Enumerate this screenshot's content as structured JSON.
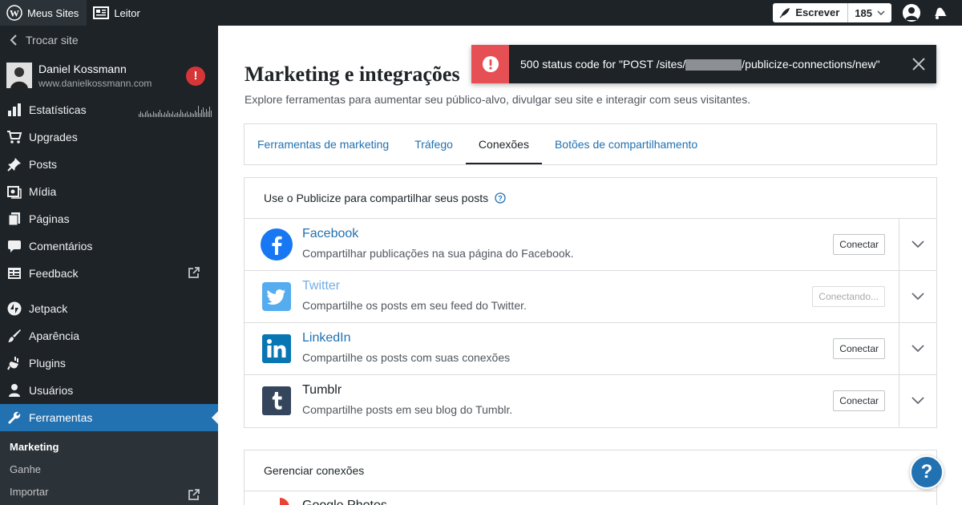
{
  "masterbar": {
    "my_sites": "Meus Sites",
    "reader": "Leitor",
    "write": "Escrever",
    "notification_count": "185"
  },
  "sidebar": {
    "switch_site": "Trocar site",
    "site_name": "Daniel Kossmann",
    "site_url": "www.danielkossmann.com",
    "site_alert": "!",
    "items": [
      {
        "label": "Estatísticas",
        "icon": "stats-icon"
      },
      {
        "label": "Upgrades",
        "icon": "cart-icon"
      },
      {
        "label": "Posts",
        "icon": "pin-icon"
      },
      {
        "label": "Mídia",
        "icon": "media-icon"
      },
      {
        "label": "Páginas",
        "icon": "pages-icon"
      },
      {
        "label": "Comentários",
        "icon": "comment-icon"
      },
      {
        "label": "Feedback",
        "icon": "feedback-icon"
      },
      {
        "label": "Jetpack",
        "icon": "jetpack-icon"
      },
      {
        "label": "Aparência",
        "icon": "brush-icon"
      },
      {
        "label": "Plugins",
        "icon": "plugin-icon"
      },
      {
        "label": "Usuários",
        "icon": "user-icon"
      },
      {
        "label": "Ferramentas",
        "icon": "wrench-icon"
      }
    ],
    "submenu": [
      {
        "label": "Marketing"
      },
      {
        "label": "Ganhe"
      },
      {
        "label": "Importar"
      }
    ]
  },
  "main": {
    "title": "Marketing e integrações",
    "subtitle": "Explore ferramentas para aumentar seu público-alvo, divulgar seu site e interagir com seus visitantes.",
    "tabs": [
      {
        "label": "Ferramentas de marketing"
      },
      {
        "label": "Tráfego"
      },
      {
        "label": "Conexões"
      },
      {
        "label": "Botões de compartilhamento"
      }
    ],
    "publicize_header": "Use o Publicize para compartilhar seus posts",
    "connections": [
      {
        "name": "Facebook",
        "desc": "Compartilhar publicações na sua página do Facebook.",
        "button": "Conectar"
      },
      {
        "name": "Twitter",
        "desc": "Compartilhe os posts em seu feed do Twitter.",
        "button": "Conectando..."
      },
      {
        "name": "LinkedIn",
        "desc": "Compartilhe os posts com suas conexões",
        "button": "Conectar"
      },
      {
        "name": "Tumblr",
        "desc": "Compartilhe posts em seu blog do Tumblr.",
        "button": "Conectar"
      }
    ],
    "manage_header": "Gerenciar conexões",
    "partial_item": "Google Photos"
  },
  "notice": {
    "text_before": "500 status code for \"POST /sites/",
    "text_after": "/publicize-connections/new\""
  },
  "help_fab": "?",
  "colors": {
    "accent": "#2271b1",
    "error": "#e65054",
    "sidebar_bg": "#1d2327"
  }
}
